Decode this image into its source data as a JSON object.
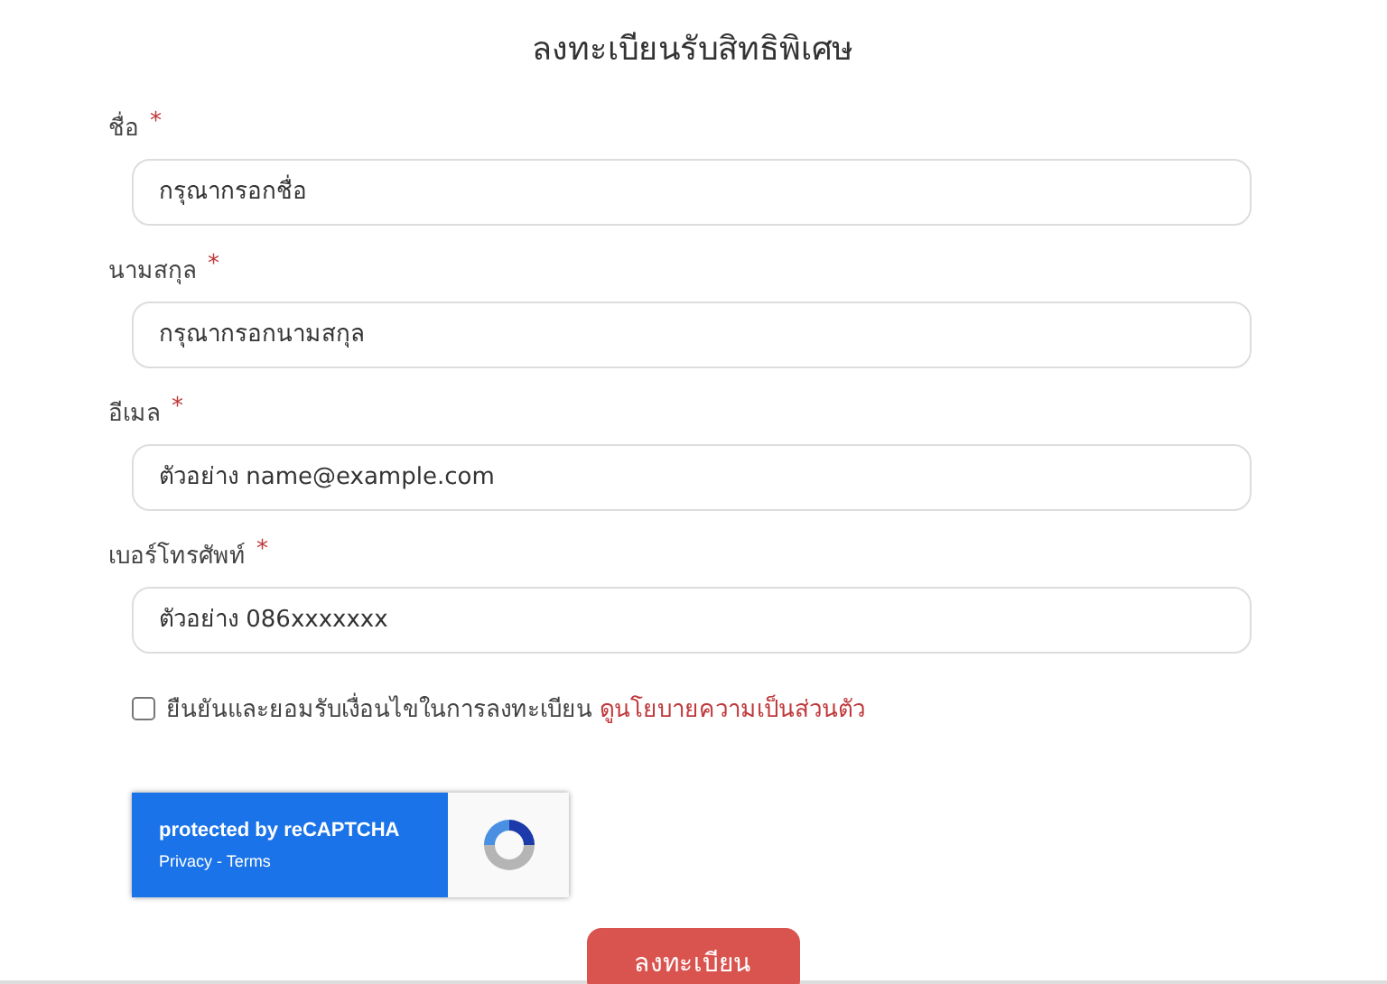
{
  "title": "ลงทะเบียนรับสิทธิพิเศษ",
  "fields": [
    {
      "label": "ชื่อ",
      "required_mark": "*",
      "placeholder": "กรุณากรอกชื่อ"
    },
    {
      "label": "นามสกุล",
      "required_mark": "*",
      "placeholder": "กรุณากรอกนามสกุล"
    },
    {
      "label": "อีเมล",
      "required_mark": "*",
      "placeholder": "ตัวอย่าง name@example.com"
    },
    {
      "label": "เบอร์โทรศัพท์",
      "required_mark": "*",
      "placeholder": "ตัวอย่าง 086xxxxxxx"
    }
  ],
  "consent": {
    "checked": false,
    "text": "ยืนยันและยอมรับเงื่อนไขในการลงทะเบียน",
    "link": "ดูนโยบายความเป็นส่วนตัว"
  },
  "recaptcha": {
    "title": "protected by reCAPTCHA",
    "links": "Privacy - Terms"
  },
  "submit": "ลงทะเบียน"
}
